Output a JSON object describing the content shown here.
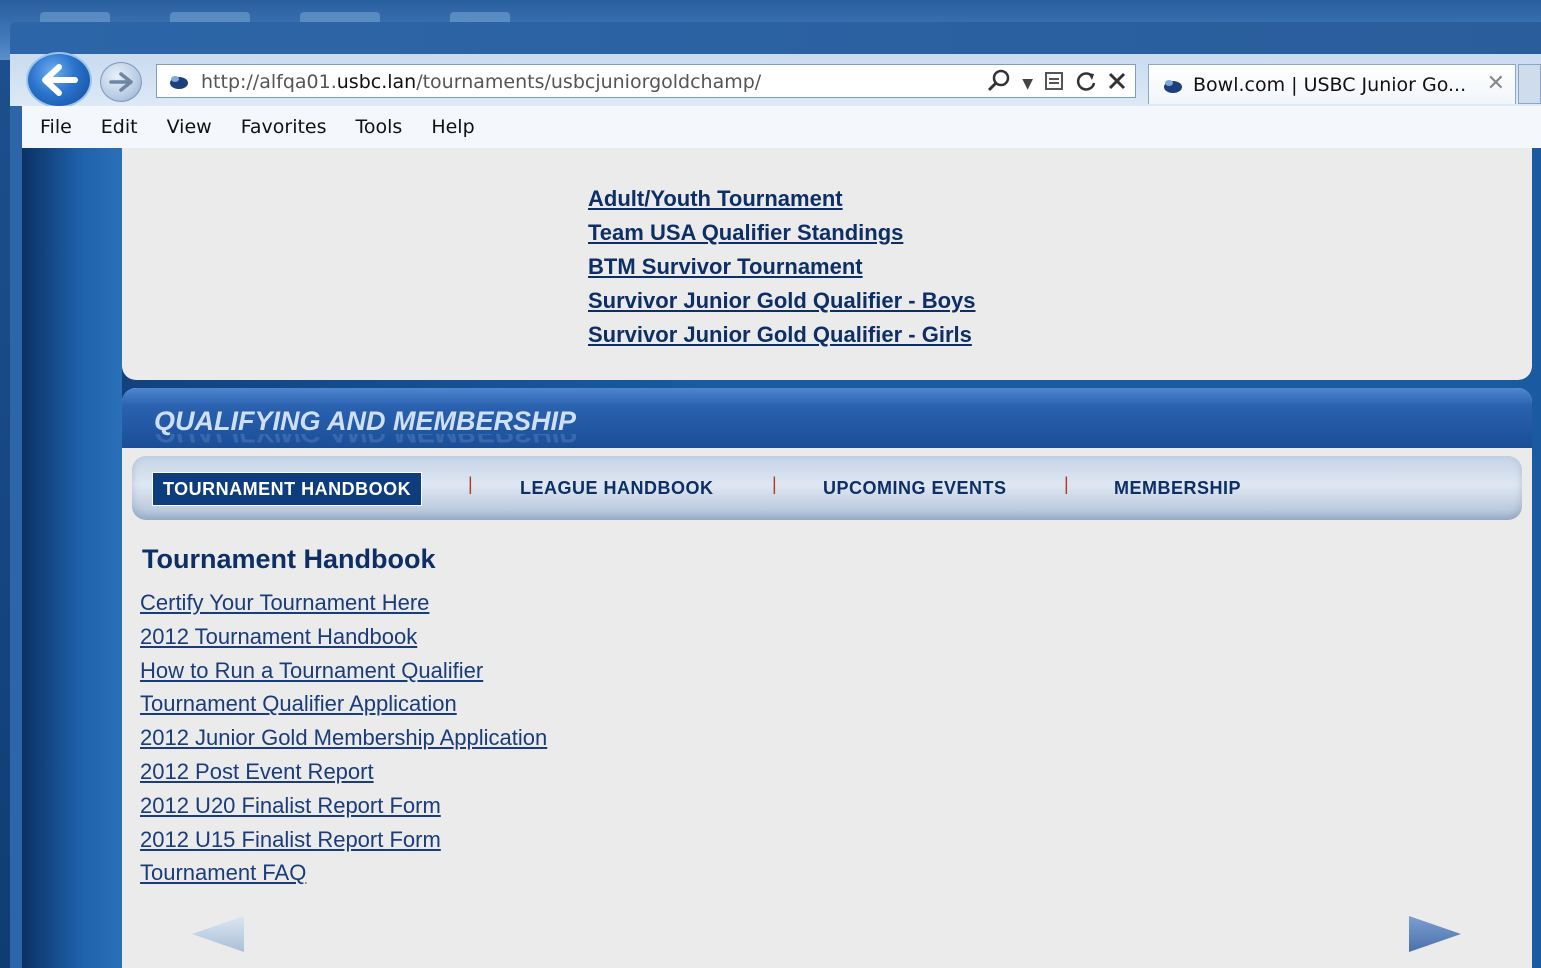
{
  "browser": {
    "url_prefix": "http://alfqa01.",
    "url_host": "usbc.lan",
    "url_path": "/tournaments/usbcjuniorgoldchamp/",
    "tab_title": "Bowl.com | USBC Junior Go...",
    "tab_close": "✕",
    "menu": [
      "File",
      "Edit",
      "View",
      "Favorites",
      "Tools",
      "Help"
    ],
    "icons": {
      "back": "back-arrow-icon",
      "forward": "forward-arrow-icon",
      "search": "search-icon",
      "compat": "compatibility-view-icon",
      "refresh": "refresh-icon",
      "stop": "stop-icon"
    }
  },
  "top_links": [
    "Adult/Youth Tournament",
    "Team USA Qualifier Standings",
    "BTM Survivor Tournament",
    "Survivor Junior Gold Qualifier - Boys",
    "Survivor Junior Gold Qualifier - Girls"
  ],
  "section": {
    "title": "QUALIFYING AND MEMBERSHIP",
    "tabs": [
      {
        "label": "TOURNAMENT HANDBOOK",
        "active": true
      },
      {
        "label": "LEAGUE HANDBOOK",
        "active": false
      },
      {
        "label": "UPCOMING EVENTS",
        "active": false
      },
      {
        "label": "MEMBERSHIP",
        "active": false
      }
    ],
    "separator": "|",
    "content_title": "Tournament Handbook",
    "links": [
      "Certify Your Tournament Here",
      "2012 Tournament Handbook",
      "How to Run a Tournament Qualifier",
      "Tournament Qualifier Application",
      "2012 Junior Gold Membership Application",
      "2012 Post Event Report",
      "2012 U20 Finalist Report Form",
      "2012 U15 Finalist Report Form",
      "Tournament FAQ"
    ]
  },
  "colors": {
    "link": "#0d2f66",
    "active_tab_bg": "#0d3d7c",
    "separator": "#b43b2c"
  }
}
